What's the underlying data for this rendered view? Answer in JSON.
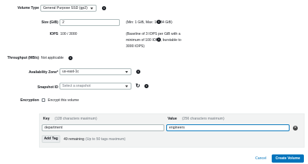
{
  "volume_type": {
    "label": "Volume Type",
    "value": "General Purpose SSD (gp2)"
  },
  "size": {
    "label": "Size (GiB)",
    "value": "2",
    "hint": "(Min: 1 GiB, Max: 16384 GiB)"
  },
  "iops": {
    "label": "IOPS",
    "value": "100 / 3000",
    "hint_lines": [
      "(Baseline of 3 IOPS per GiB with a",
      "minimum of 100 IOPS, burstable to",
      "3000 IOPS)"
    ]
  },
  "throughput": {
    "label": "Throughput (MB/s)",
    "value": "Not applicable"
  },
  "availability_zone": {
    "label": "Availability Zone*",
    "value": "us-east-1c"
  },
  "snapshot": {
    "label": "Snapshot ID",
    "placeholder": "Select a snapshot"
  },
  "encryption": {
    "label": "Encryption",
    "checkbox_label": "Encrypt this volume",
    "checked": false
  },
  "tags": {
    "key_header": "Key",
    "key_hint": "(128 characters maximum)",
    "value_header": "Value",
    "value_hint": "(256 characters maximum)",
    "rows": [
      {
        "key": "department",
        "value": "engineers"
      }
    ],
    "add_tag_label": "Add Tag",
    "remaining": "49 remaining",
    "limit_hint": "(Up to 50 tags maximum)"
  },
  "footer": {
    "cancel_label": "Cancel",
    "create_label": "Create Volume"
  },
  "icons": {
    "info": "info-icon",
    "refresh": "refresh-icon",
    "remove": "remove-tag-icon"
  },
  "colors": {
    "primary": "#0073bb",
    "focus_border": "#0073bb"
  }
}
